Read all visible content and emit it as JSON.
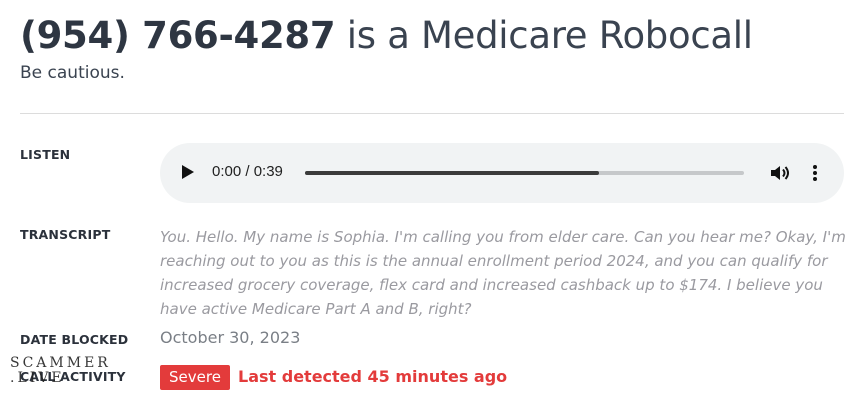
{
  "header": {
    "number": "(954) 766-4287",
    "title_rest": " is a Medicare Robocall",
    "subtitle": "Be cautious."
  },
  "labels": {
    "listen": "LISTEN",
    "transcript": "TRANSCRIPT",
    "date_blocked": "DATE BLOCKED",
    "call_activity": "CALL ACTIVITY"
  },
  "player": {
    "time": "0:00 / 0:39",
    "progress": 0.67,
    "play_icon": "play-icon",
    "volume_icon": "volume-icon",
    "more_icon": "more-options-icon"
  },
  "transcript": "You. Hello. My name is Sophia. I'm calling you from elder care. Can you hear me? Okay, I'm reaching out to you as this is the annual enrollment period 2024, and you can qualify for increased grocery coverage, flex card and increased cashback up to $174. I believe you have active Medicare Part A and B, right?",
  "date_blocked": "October 30, 2023",
  "call_activity": {
    "severity": "Severe",
    "last_detected": "Last detected 45 minutes ago"
  },
  "watermark": {
    "line1": "SCAMMER",
    "line2": ".LIVE"
  },
  "colors": {
    "alert": "#e33b3b",
    "player_bg": "#f1f3f4"
  }
}
